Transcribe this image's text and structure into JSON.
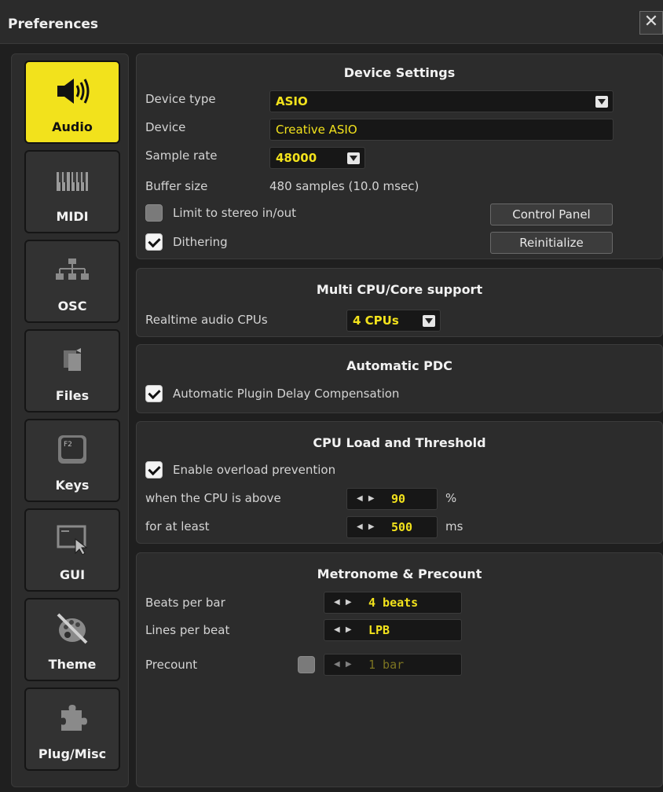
{
  "window": {
    "title": "Preferences",
    "close_glyph": "✕"
  },
  "sidebar": {
    "tabs": [
      {
        "label": "Audio",
        "icon": "speaker-icon",
        "active": true
      },
      {
        "label": "MIDI",
        "icon": "piano-keys-icon",
        "active": false
      },
      {
        "label": "OSC",
        "icon": "network-icon",
        "active": false
      },
      {
        "label": "Files",
        "icon": "files-icon",
        "active": false
      },
      {
        "label": "Keys",
        "icon": "keyboard-key-icon",
        "active": false
      },
      {
        "label": "GUI",
        "icon": "gui-cursor-icon",
        "active": false
      },
      {
        "label": "Theme",
        "icon": "palette-icon",
        "active": false
      },
      {
        "label": "Plug/Misc",
        "icon": "puzzle-icon",
        "active": false
      }
    ],
    "key_cap_text": "F2"
  },
  "device": {
    "title": "Device Settings",
    "device_type_label": "Device type",
    "device_type_value": "ASIO",
    "device_label": "Device",
    "device_value": "Creative ASIO",
    "sample_rate_label": "Sample rate",
    "sample_rate_value": "48000",
    "buffer_label": "Buffer size",
    "buffer_value": "480 samples (10.0 msec)",
    "stereo_label": "Limit to stereo in/out",
    "stereo_checked": false,
    "dithering_label": "Dithering",
    "dithering_checked": true,
    "control_panel_label": "Control Panel",
    "reinitialize_label": "Reinitialize"
  },
  "cpu": {
    "title": "Multi CPU/Core support",
    "label": "Realtime audio CPUs",
    "value": "4 CPUs"
  },
  "pdc": {
    "title": "Automatic PDC",
    "label": "Automatic Plugin Delay Compensation",
    "checked": true
  },
  "load": {
    "title": "CPU Load and Threshold",
    "enable_label": "Enable overload prevention",
    "enable_checked": true,
    "above_label": "when the CPU is above",
    "above_value": "90",
    "above_unit": "%",
    "least_label": "for at least",
    "least_value": "500",
    "least_unit": "ms"
  },
  "metro": {
    "title": "Metronome & Precount",
    "beats_label": "Beats per bar",
    "beats_value": "4 beats",
    "lines_label": "Lines per beat",
    "lines_value": "LPB",
    "precount_label": "Precount",
    "precount_checked": false,
    "precount_value": "1 bar"
  },
  "colors": {
    "accent": "#f2e21c",
    "panel": "#2c2c2c",
    "background": "#1f1f1f"
  }
}
